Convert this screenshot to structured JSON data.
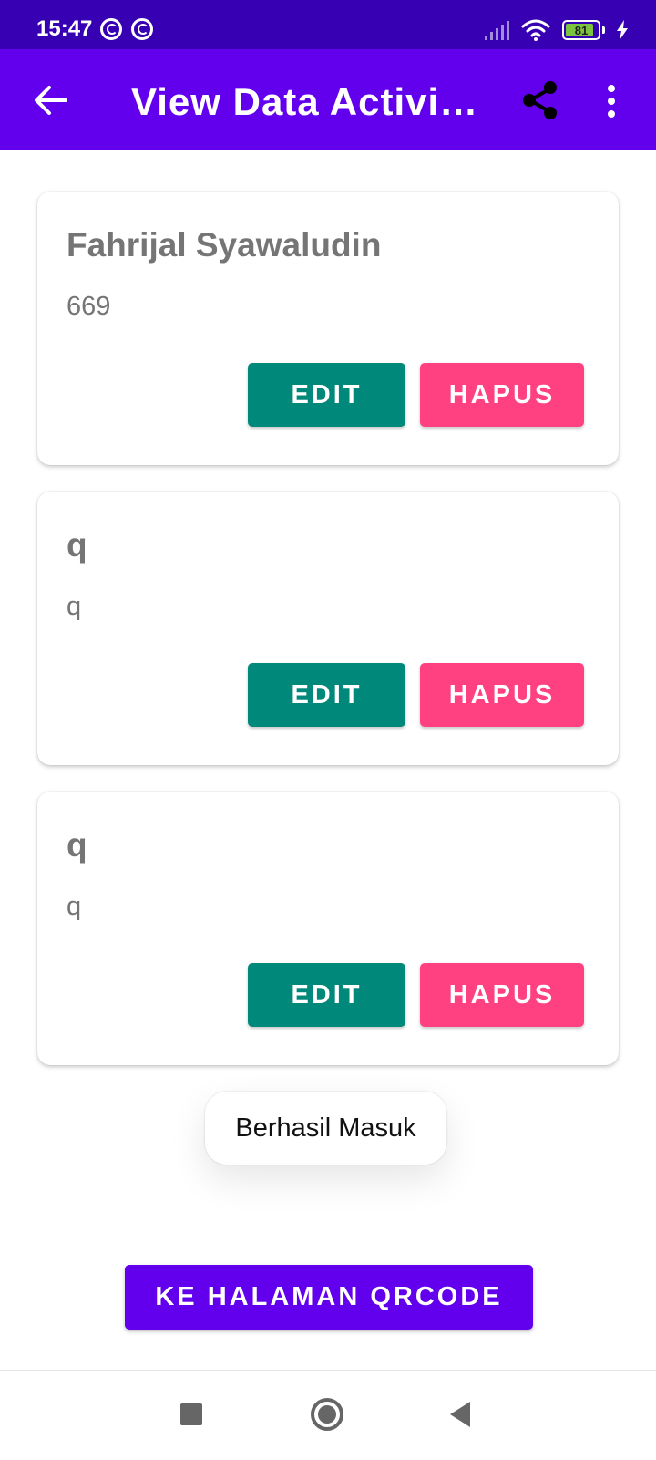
{
  "status_bar": {
    "time": "15:47",
    "battery": "81"
  },
  "app_bar": {
    "title": "View Data Activi…"
  },
  "cards": [
    {
      "name": "Fahrijal Syawaludin",
      "value": "669",
      "edit_label": "EDIT",
      "delete_label": "HAPUS"
    },
    {
      "name": "q",
      "value": "q",
      "edit_label": "EDIT",
      "delete_label": "HAPUS"
    },
    {
      "name": "q",
      "value": "q",
      "edit_label": "EDIT",
      "delete_label": "HAPUS"
    }
  ],
  "toast": {
    "text": "Berhasil Masuk"
  },
  "qr_button": {
    "label": "KE HALAMAN QRCODE"
  },
  "colors": {
    "status_bar": "#3700b3",
    "primary": "#6200ee",
    "edit_button": "#00897b",
    "delete_button": "#ff4081",
    "card_text": "#757575"
  },
  "icons": {
    "app_bar": [
      "back-arrow-icon",
      "share-icon",
      "more-vert-icon"
    ],
    "navigation": [
      "recent-apps-icon",
      "home-icon",
      "back-triangle-icon"
    ]
  }
}
